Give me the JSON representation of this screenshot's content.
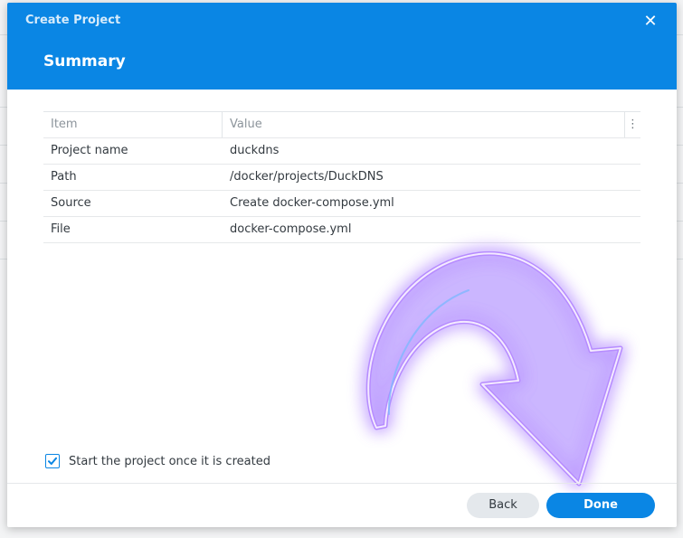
{
  "dialog": {
    "title": "Create Project",
    "step_title": "Summary",
    "close_icon": "close-icon"
  },
  "table": {
    "columns": [
      "Item",
      "Value"
    ],
    "column_menu_icon": "⋮",
    "rows": [
      {
        "item": "Project name",
        "value": "duckdns"
      },
      {
        "item": "Path",
        "value": "/docker/projects/DuckDNS"
      },
      {
        "item": "Source",
        "value": "Create docker-compose.yml"
      },
      {
        "item": "File",
        "value": "docker-compose.yml"
      }
    ]
  },
  "options": {
    "start_label": "Start the project once it is created",
    "start_checked": true
  },
  "footer": {
    "back_label": "Back",
    "done_label": "Done"
  },
  "colors": {
    "accent": "#0a86e4",
    "arrow_glow": "#8a4dff"
  }
}
